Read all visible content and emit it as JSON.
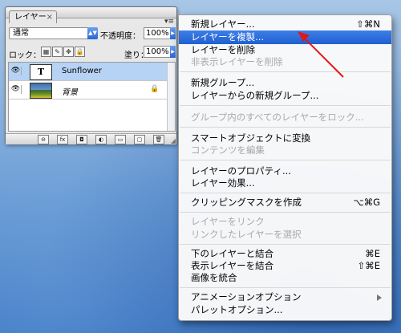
{
  "palette": {
    "tab_label": "レイヤー",
    "tab_close": "×",
    "menu_glyph": "▾≡",
    "blend_mode": "通常",
    "opacity_label": "不透明度：",
    "opacity_value": "100%",
    "lock_label": "ロック：",
    "fill_label": "塗り：",
    "fill_value": "100%",
    "layers": [
      {
        "name": "Sunflower",
        "thumb": "T",
        "selected": true,
        "italic": false
      },
      {
        "name": "背景",
        "thumb": "image",
        "selected": false,
        "italic": true,
        "locked": true
      }
    ],
    "footer_icons": [
      "link-icon",
      "fx-icon",
      "mask-icon",
      "adjustment-icon",
      "folder-icon",
      "new-layer-icon",
      "trash-icon"
    ],
    "footer_glyphs": [
      "⊖",
      "fx",
      "◘",
      "◐",
      "▭",
      "▢",
      "🗑"
    ]
  },
  "menu": {
    "items": [
      {
        "label": "新規レイヤー...",
        "shortcut": "⇧⌘N"
      },
      {
        "label": "レイヤーを複製...",
        "highlight": true
      },
      {
        "label": "レイヤーを削除"
      },
      {
        "label": "非表示レイヤーを削除",
        "disabled": true
      },
      {
        "label": "新規グループ..."
      },
      {
        "label": "レイヤーからの新規グループ..."
      },
      {
        "label": "グループ内のすべてのレイヤーをロック...",
        "disabled": true
      },
      {
        "label": "スマートオブジェクトに変換"
      },
      {
        "label": "コンテンツを編集",
        "disabled": true
      },
      {
        "label": "レイヤーのプロパティ..."
      },
      {
        "label": "レイヤー効果..."
      },
      {
        "label": "クリッピングマスクを作成",
        "shortcut": "⌥⌘G"
      },
      {
        "label": "レイヤーをリンク",
        "disabled": true
      },
      {
        "label": "リンクしたレイヤーを選択",
        "disabled": true
      },
      {
        "label": "下のレイヤーと結合",
        "shortcut": "⌘E"
      },
      {
        "label": "表示レイヤーを結合",
        "shortcut": "⇧⌘E"
      },
      {
        "label": "画像を統合"
      },
      {
        "label": "アニメーションオプション",
        "submenu": true
      },
      {
        "label": "パレットオプション..."
      }
    ]
  },
  "colors": {
    "highlight": "#1f5fd1",
    "selected_layer": "#b6d2f4",
    "annotation_arrow": "#e01818"
  }
}
